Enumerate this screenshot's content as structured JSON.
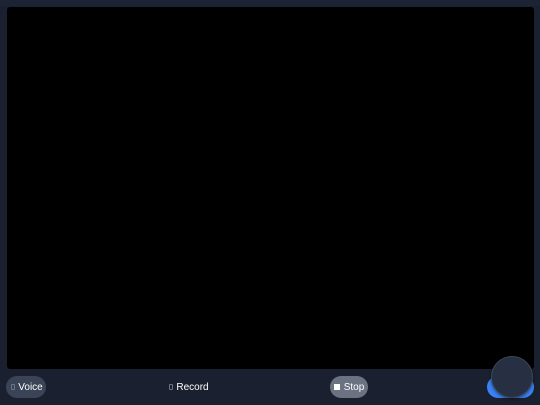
{
  "colors": {
    "background": "#1a2030",
    "video": "#000000",
    "voice_button": "#3a4456",
    "stop_button": "#6b7282",
    "primary_button": "#3b82f6",
    "fab": "#263042"
  },
  "controls": {
    "voice": {
      "label": "Voice",
      "icon": "microphone-icon"
    },
    "record": {
      "label": "Record",
      "icon": "record-icon"
    },
    "stop": {
      "label": "Stop",
      "icon": "stop-square-icon"
    },
    "primary": {
      "label": ""
    }
  },
  "fab": {
    "icon": "floating-action-icon"
  }
}
